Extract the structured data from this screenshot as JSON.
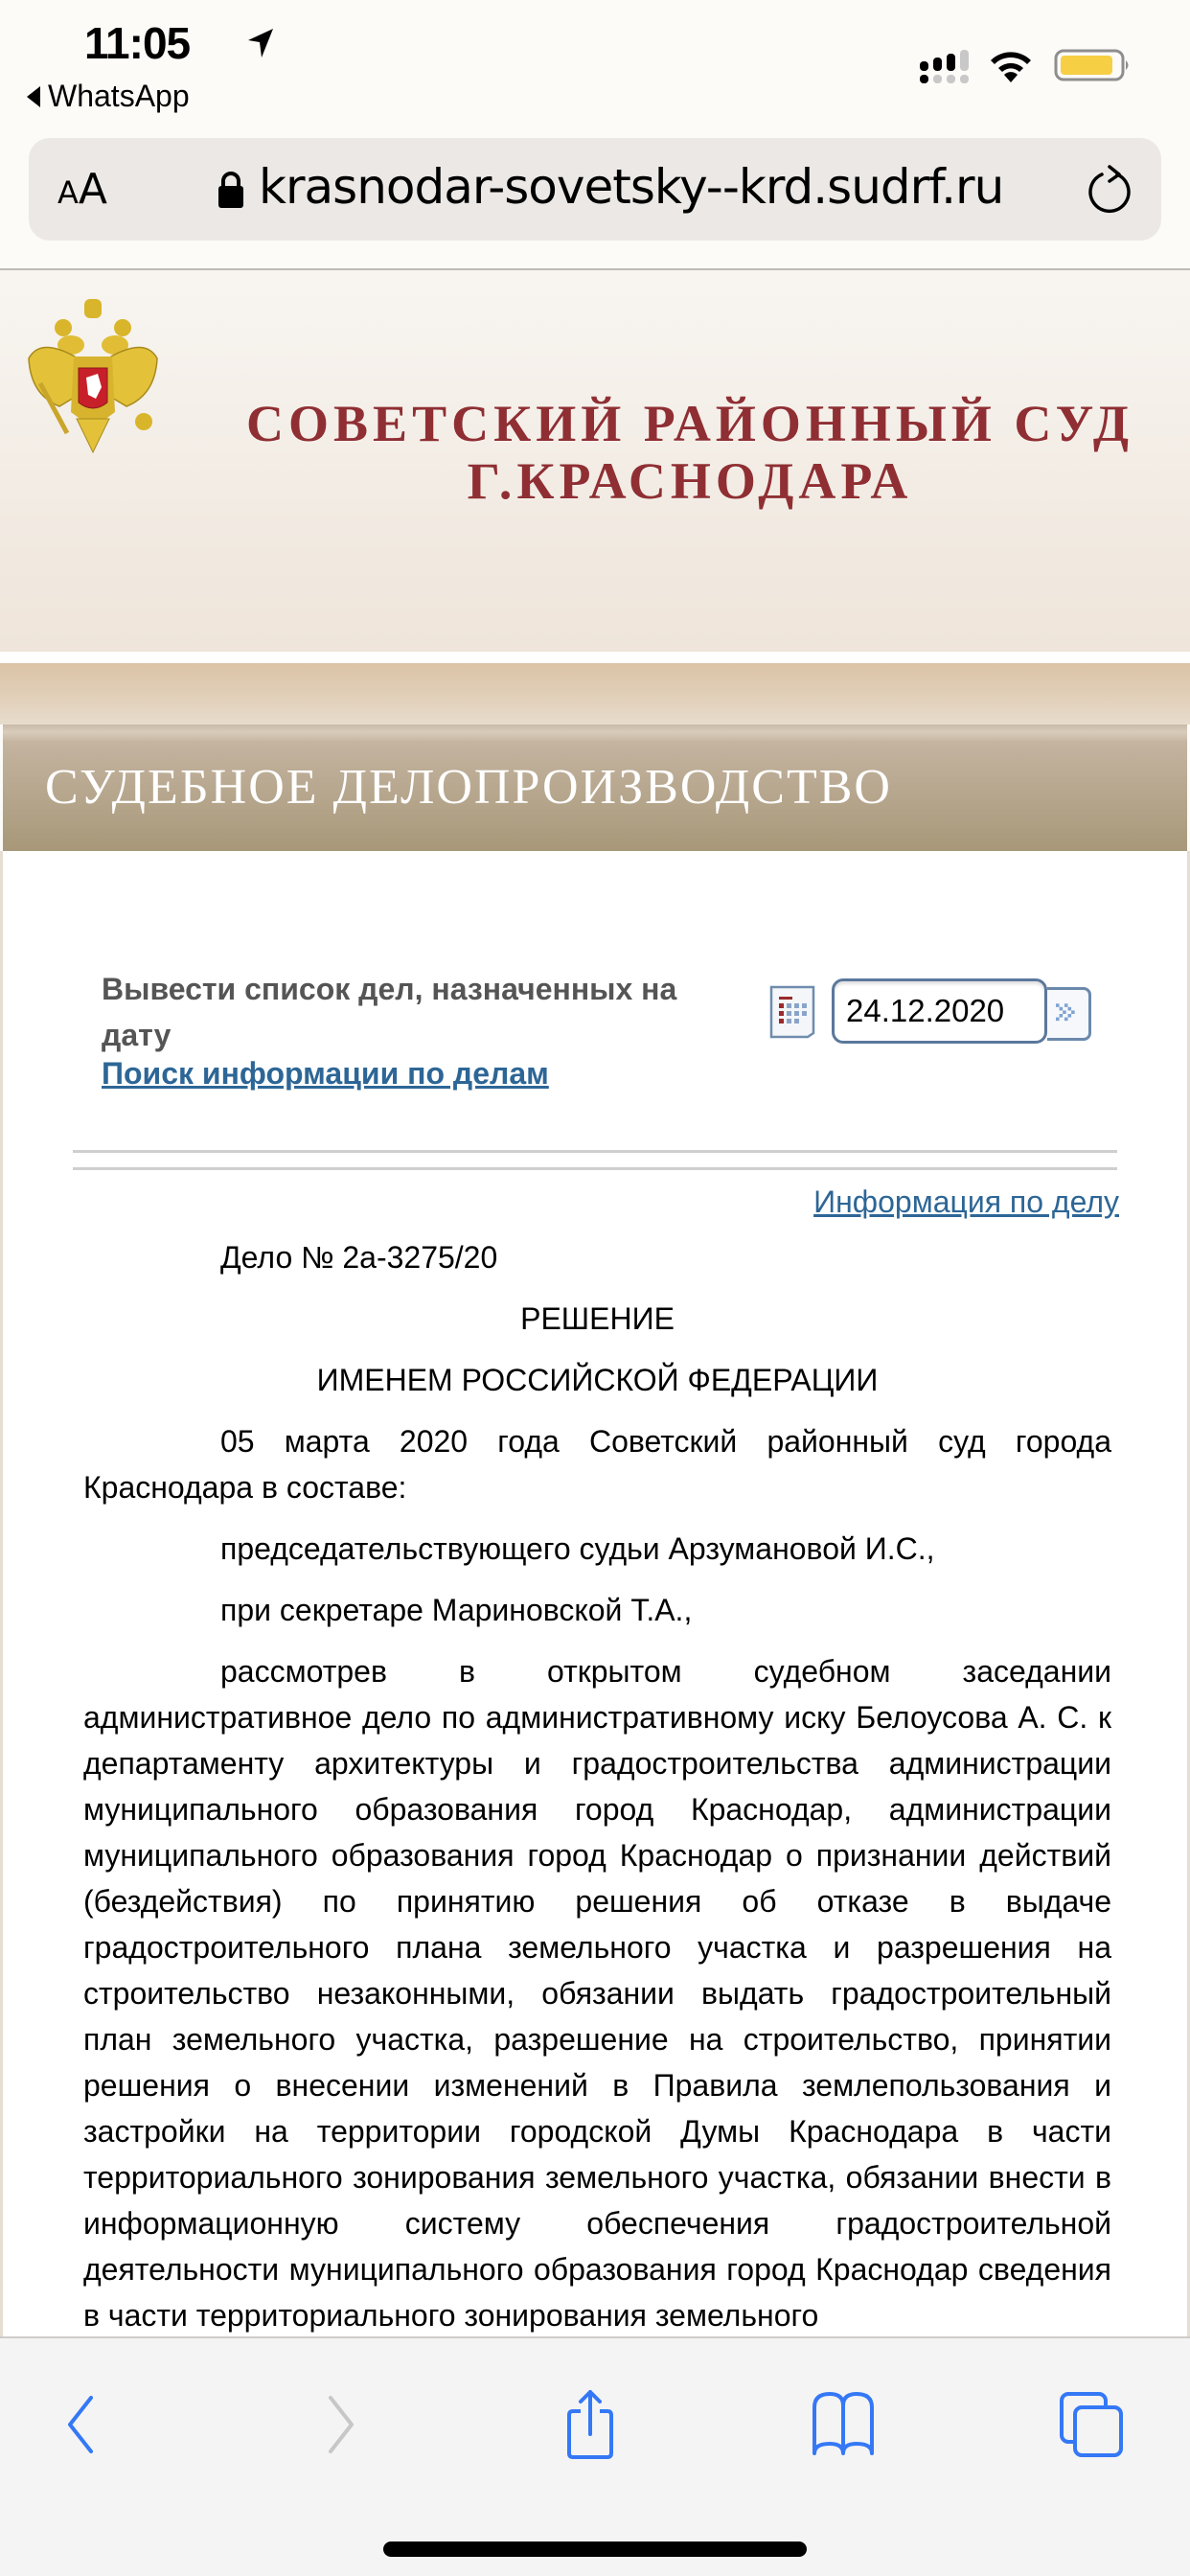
{
  "status_bar": {
    "time": "11:05",
    "back_app": "WhatsApp",
    "signal_primary_bars": 3,
    "signal_secondary_bars": 1,
    "signal_max_bars": 4,
    "battery_color": "#f7cf45",
    "battery_level": 0.9
  },
  "browser": {
    "text_size_button": {
      "small": "A",
      "large": "A"
    },
    "url": "krasnodar-sovetsky--krd.sudrf.ru",
    "toolbar": {
      "back": "back",
      "forward": "forward",
      "share": "share",
      "bookmarks": "bookmarks",
      "tabs": "tabs"
    },
    "accent_color": "#3478f6",
    "disabled_color": "#c7c7c7"
  },
  "site": {
    "court_title_line1": "СОВЕТСКИЙ РАЙОННЫЙ СУД",
    "court_title_line2": "Г.КРАСНОДАРА",
    "court_title_color": "#8f2f33",
    "section_title": "СУДЕБНОЕ ДЕЛОПРОИЗВОДСТВО",
    "filter_label": "Вывести список дел, назначенных на дату",
    "date_value": "24.12.2020",
    "search_link": "Поиск информации по делам",
    "case_info_link": "Информация по делу",
    "link_color": "#2d6696"
  },
  "document": {
    "case_number": "Дело № 2а-3275/20",
    "heading": "РЕШЕНИЕ",
    "subheading": "ИМЕНЕМ РОССИЙСКОЙ ФЕДЕРАЦИИ",
    "intro": "05 марта 2020 года Советский районный суд города Краснодара в составе:",
    "judge": "председательствующего судьи Арзумановой И.С.,",
    "secretary": "при секретаре Мариновской Т.А.,",
    "body": "рассмотрев в открытом судебном заседании административное дело по административному иску Белоусова А. С. к департаменту архитектуры и градостроительства администрации муниципального образования город Краснодар, администрации муниципального образования город Краснодар о признании действий (бездействия) по принятию решения об отказе в выдаче градостроительного плана земельного участка и разрешения на строительство незаконными, обязании выдать градостроительный план земельного участка, разрешение на строительство, принятии решения о внесении изменений в Правила землепользования и застройки на территории городской Думы Краснодара в части территориального зонирования земельного участка, обязании внести в информационную систему обеспечения градостроительной деятельности муниципального образования город Краснодар сведения в части территориального зонирования земельного"
  }
}
